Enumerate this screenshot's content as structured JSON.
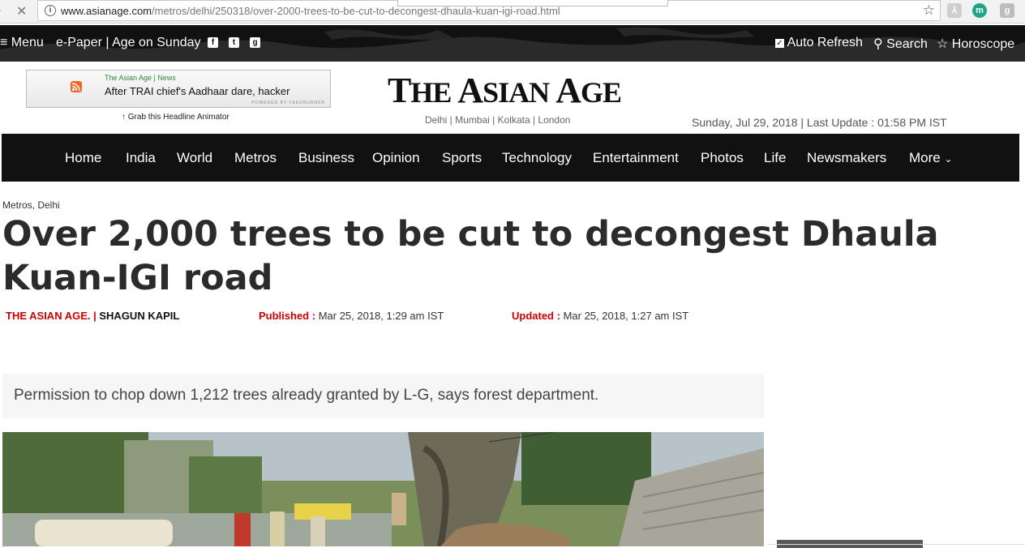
{
  "browser": {
    "back_icon": "back-arrow-icon",
    "stop_glyph": "✕",
    "url_domain": "www.asianage.com",
    "url_path": "/metros/delhi/250318/over-2000-trees-to-be-cut-to-decongest-dhaula-kuan-igi-road.html",
    "extensions": [
      {
        "name": "pdf-extension-icon",
        "glyph": "⅄",
        "color": "#cccccc"
      },
      {
        "name": "m-extension-icon",
        "glyph": "m",
        "color": "#1fa58a"
      },
      {
        "name": "google-extension-icon",
        "glyph": "g",
        "color": "#bbbbbb"
      }
    ]
  },
  "topbar": {
    "menu": "Menu",
    "epaper": "e-Paper | Age on Sunday",
    "auto_refresh": "Auto Refresh",
    "search": "Search",
    "horoscope": "Horoscope"
  },
  "ticker": {
    "source": "The Asian Age | News",
    "headline": "After TRAI chief's Aadhaar dare, hacker",
    "powered": "POWERED BY FEEDBURNER",
    "grab": "↑ Grab this Headline Animator"
  },
  "logo": {
    "t": "T",
    "he": "HE ",
    "a1": "A",
    "sian": "SIAN ",
    "a2": "A",
    "ge": "GE"
  },
  "editions": "Delhi | Mumbai | Kolkata | London",
  "dateline": "Sunday, Jul 29, 2018 | Last Update : 01:58 PM IST",
  "nav": {
    "items": [
      "Home",
      "India",
      "World",
      "Metros",
      "Business",
      "Opinion",
      "Sports",
      "Technology",
      "Entertainment",
      "Photos",
      "Life",
      "Newsmakers",
      "More"
    ]
  },
  "article": {
    "breadcrumb": "Metros, Delhi",
    "title": "Over 2,000 trees to be cut to decongest Dhaula Kuan-IGI road",
    "source": "THE ASIAN AGE. |",
    "author": "SHAGUN KAPIL",
    "published_label": "Published :",
    "published_value": "Mar 25, 2018, 1:29 am IST",
    "updated_label": "Updated :",
    "updated_value": "Mar 25, 2018, 1:27 am IST",
    "summary": "Permission to chop down 1,212 trees already granted by L-G, says forest department."
  },
  "colors": {
    "accent_red": "#cc0000",
    "nav_bg": "#111111",
    "rss": "#f26522"
  }
}
